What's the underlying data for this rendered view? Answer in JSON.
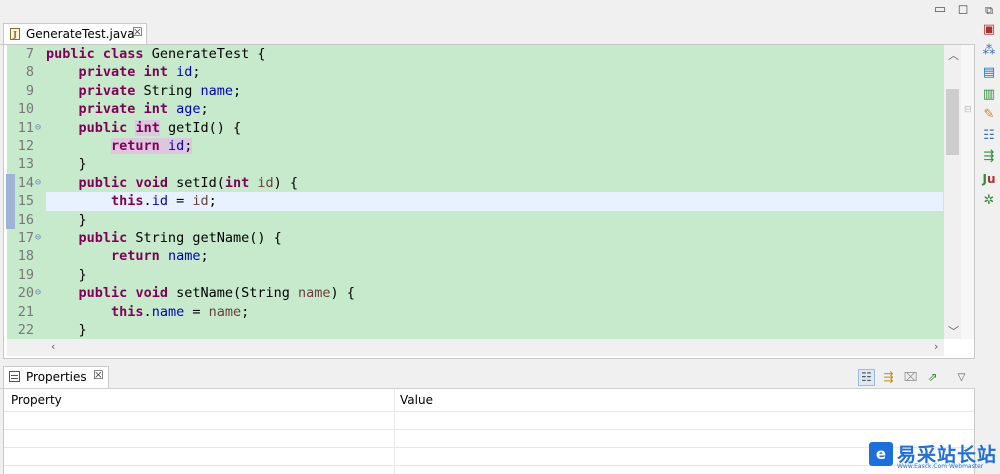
{
  "editor": {
    "tab_label": "GenerateTest.java",
    "tab_close": "☒",
    "lines": [
      {
        "num": "7",
        "fold": "",
        "tokens": [
          [
            "kw",
            "public"
          ],
          [
            "t",
            " "
          ],
          [
            "kw",
            "class"
          ],
          [
            "t",
            " GenerateTest {"
          ]
        ]
      },
      {
        "num": "8",
        "fold": "",
        "tokens": [
          [
            "t",
            "    "
          ],
          [
            "kw",
            "private"
          ],
          [
            "t",
            " "
          ],
          [
            "kw",
            "int"
          ],
          [
            "t",
            " "
          ],
          [
            "fld",
            "id"
          ],
          [
            "t",
            ";"
          ]
        ]
      },
      {
        "num": "9",
        "fold": "",
        "tokens": [
          [
            "t",
            "    "
          ],
          [
            "kw",
            "private"
          ],
          [
            "t",
            " String "
          ],
          [
            "fld",
            "name"
          ],
          [
            "t",
            ";"
          ]
        ]
      },
      {
        "num": "10",
        "fold": "",
        "tokens": [
          [
            "t",
            "    "
          ],
          [
            "kw",
            "private"
          ],
          [
            "t",
            " "
          ],
          [
            "kw",
            "int"
          ],
          [
            "t",
            " "
          ],
          [
            "fld",
            "age"
          ],
          [
            "t",
            ";"
          ]
        ]
      },
      {
        "num": "11",
        "fold": "⊖",
        "tokens": [
          [
            "t",
            "    "
          ],
          [
            "kw",
            "public"
          ],
          [
            "t",
            " "
          ],
          [
            "kw occ",
            "int"
          ],
          [
            "t",
            " getId() {"
          ]
        ]
      },
      {
        "num": "12",
        "fold": "",
        "tokens": [
          [
            "t",
            "        "
          ],
          [
            "kw occ",
            "return"
          ],
          [
            "occ",
            " "
          ],
          [
            "fld occ",
            "id"
          ],
          [
            "occ",
            ";"
          ]
        ]
      },
      {
        "num": "13",
        "fold": "",
        "tokens": [
          [
            "t",
            "    }"
          ]
        ]
      },
      {
        "num": "14",
        "fold": "⊖",
        "tokens": [
          [
            "t",
            "    "
          ],
          [
            "kw",
            "public"
          ],
          [
            "t",
            " "
          ],
          [
            "kw",
            "void"
          ],
          [
            "t",
            " setId("
          ],
          [
            "kw",
            "int"
          ],
          [
            "t",
            " "
          ],
          [
            "prm",
            "id"
          ],
          [
            "t",
            ") {"
          ]
        ]
      },
      {
        "num": "15",
        "fold": "",
        "tokens": [
          [
            "t",
            "        "
          ],
          [
            "kw",
            "this"
          ],
          [
            "t",
            "."
          ],
          [
            "fld",
            "id"
          ],
          [
            "t",
            " = "
          ],
          [
            "prm",
            "id"
          ],
          [
            "t",
            ";"
          ]
        ]
      },
      {
        "num": "16",
        "fold": "",
        "tokens": [
          [
            "t",
            "    }"
          ]
        ]
      },
      {
        "num": "17",
        "fold": "⊖",
        "tokens": [
          [
            "t",
            "    "
          ],
          [
            "kw",
            "public"
          ],
          [
            "t",
            " String getName() {"
          ]
        ]
      },
      {
        "num": "18",
        "fold": "",
        "tokens": [
          [
            "t",
            "        "
          ],
          [
            "kw",
            "return"
          ],
          [
            "t",
            " "
          ],
          [
            "fld",
            "name"
          ],
          [
            "t",
            ";"
          ]
        ]
      },
      {
        "num": "19",
        "fold": "",
        "tokens": [
          [
            "t",
            "    }"
          ]
        ]
      },
      {
        "num": "20",
        "fold": "⊖",
        "tokens": [
          [
            "t",
            "    "
          ],
          [
            "kw",
            "public"
          ],
          [
            "t",
            " "
          ],
          [
            "kw",
            "void"
          ],
          [
            "t",
            " setName(String "
          ],
          [
            "prm",
            "name"
          ],
          [
            "t",
            ") {"
          ]
        ]
      },
      {
        "num": "21",
        "fold": "",
        "tokens": [
          [
            "t",
            "        "
          ],
          [
            "kw",
            "this"
          ],
          [
            "t",
            "."
          ],
          [
            "fld",
            "name"
          ],
          [
            "t",
            " = "
          ],
          [
            "prm",
            "name"
          ],
          [
            "t",
            ";"
          ]
        ]
      },
      {
        "num": "22",
        "fold": "",
        "tokens": [
          [
            "t",
            "    }"
          ]
        ]
      }
    ],
    "current_line": "15",
    "coverage_color": "#c7e9cc",
    "current_line_color": "#e8f2fe"
  },
  "window": {
    "minimize": "▭",
    "maximize": "◻"
  },
  "properties": {
    "tab_label": "Properties",
    "tab_close": "☒",
    "col_property": "Property",
    "col_value": "Value"
  },
  "toolbar_icons": [
    "restore-icon",
    "task-list-icon",
    "hierarchy-icon",
    "console-icon",
    "servers-icon",
    "search-icon",
    "outline-icon",
    "git-icon",
    "junit-icon",
    "debug-icon"
  ],
  "watermark": {
    "brand": "易采站长站",
    "url": "Www.Easck.Com Webmaster"
  }
}
